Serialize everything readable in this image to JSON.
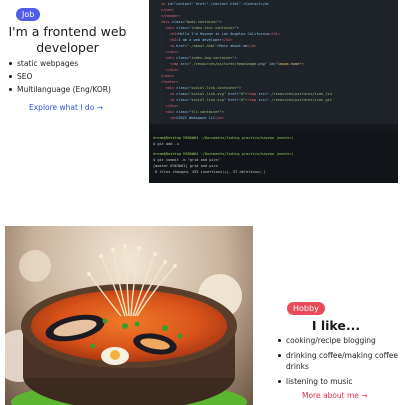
{
  "section1": {
    "badge": "Job",
    "title": "I'm a frontend web developer",
    "items": [
      "static webpages",
      "SEO",
      "Multilanguage (Eng/KOR)"
    ],
    "link": "Explore what I do →",
    "image_alt": "code editor with terminal"
  },
  "section2": {
    "badge": "Hobby",
    "title": "I like...",
    "items": [
      "cooking/recipe blogging",
      "drinking coffee/making coffee drinks",
      "listening to music"
    ],
    "link": "More about me →",
    "image_alt": "seafood soup in a stone pot"
  },
  "colors": {
    "job_badge": "#4f5ee8",
    "hobby_badge": "#e84a5a",
    "link_blue": "#2d4ce0",
    "link_red": "#e0334a"
  }
}
